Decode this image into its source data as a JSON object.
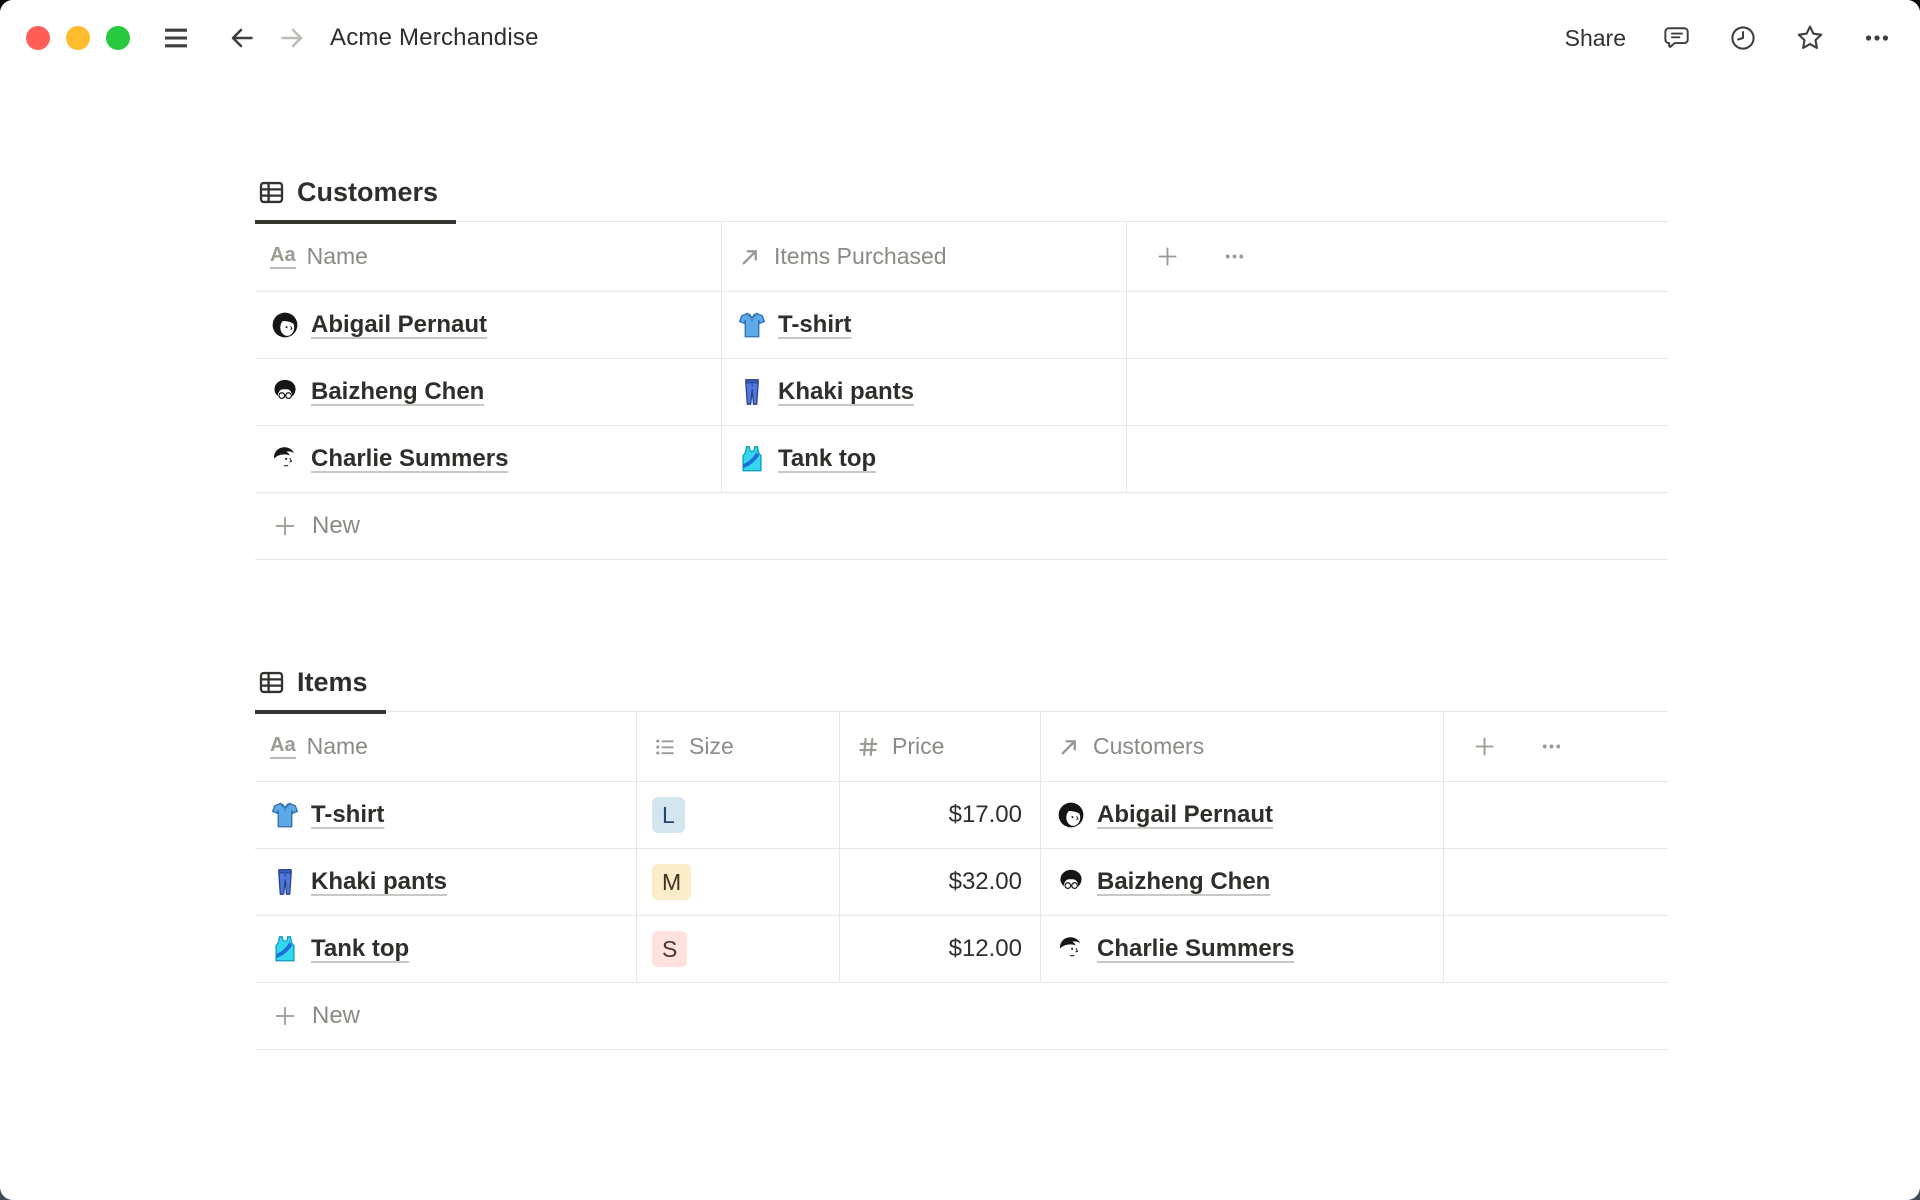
{
  "window": {
    "title": "Acme Merchandise",
    "toolbar": {
      "share_label": "Share",
      "icons": [
        "comment-icon",
        "history-clock-icon",
        "star-icon",
        "more-icon"
      ]
    }
  },
  "colors": {
    "text": "#37352f",
    "muted": "#8b8a84",
    "border": "#e7e6e3",
    "link_underline": "#c9c8c3",
    "badge_blue_bg": "#d3e5ef",
    "badge_blue_text": "#26456b",
    "badge_yellow_bg": "#fdecc8",
    "badge_yellow_text": "#3f3422",
    "badge_red_bg": "#ffe2dd",
    "badge_red_text": "#4c3431",
    "traffic_red": "#ff5f57",
    "traffic_yellow": "#febc2e",
    "traffic_green": "#28c840"
  },
  "customers_table": {
    "tab_label": "Customers",
    "tab_icon": "table-icon",
    "columns": [
      {
        "label": "Name",
        "icon": "text-icon"
      },
      {
        "label": "Items Purchased",
        "icon": "relation-icon"
      }
    ],
    "rows": [
      {
        "name": "Abigail Pernaut",
        "avatar": "abigail-avatar",
        "item": "T-shirt",
        "item_icon": "tshirt-icon"
      },
      {
        "name": "Baizheng Chen",
        "avatar": "baizheng-avatar",
        "item": "Khaki pants",
        "item_icon": "pants-icon"
      },
      {
        "name": "Charlie Summers",
        "avatar": "charlie-avatar",
        "item": "Tank top",
        "item_icon": "tanktop-icon"
      }
    ],
    "new_label": "New"
  },
  "items_table": {
    "tab_label": "Items",
    "tab_icon": "table-icon",
    "columns": [
      {
        "label": "Name",
        "icon": "text-icon"
      },
      {
        "label": "Size",
        "icon": "select-icon"
      },
      {
        "label": "Price",
        "icon": "number-icon"
      },
      {
        "label": "Customers",
        "icon": "relation-icon"
      }
    ],
    "rows": [
      {
        "name": "T-shirt",
        "icon": "tshirt-icon",
        "size": "L",
        "size_color": "blue",
        "price": "$17.00",
        "customer": "Abigail Pernaut",
        "customer_avatar": "abigail-avatar"
      },
      {
        "name": "Khaki pants",
        "icon": "pants-icon",
        "size": "M",
        "size_color": "yellow",
        "price": "$32.00",
        "customer": "Baizheng Chen",
        "customer_avatar": "baizheng-avatar"
      },
      {
        "name": "Tank top",
        "icon": "tanktop-icon",
        "size": "S",
        "size_color": "red",
        "price": "$12.00",
        "customer": "Charlie Summers",
        "customer_avatar": "charlie-avatar"
      }
    ],
    "new_label": "New"
  }
}
